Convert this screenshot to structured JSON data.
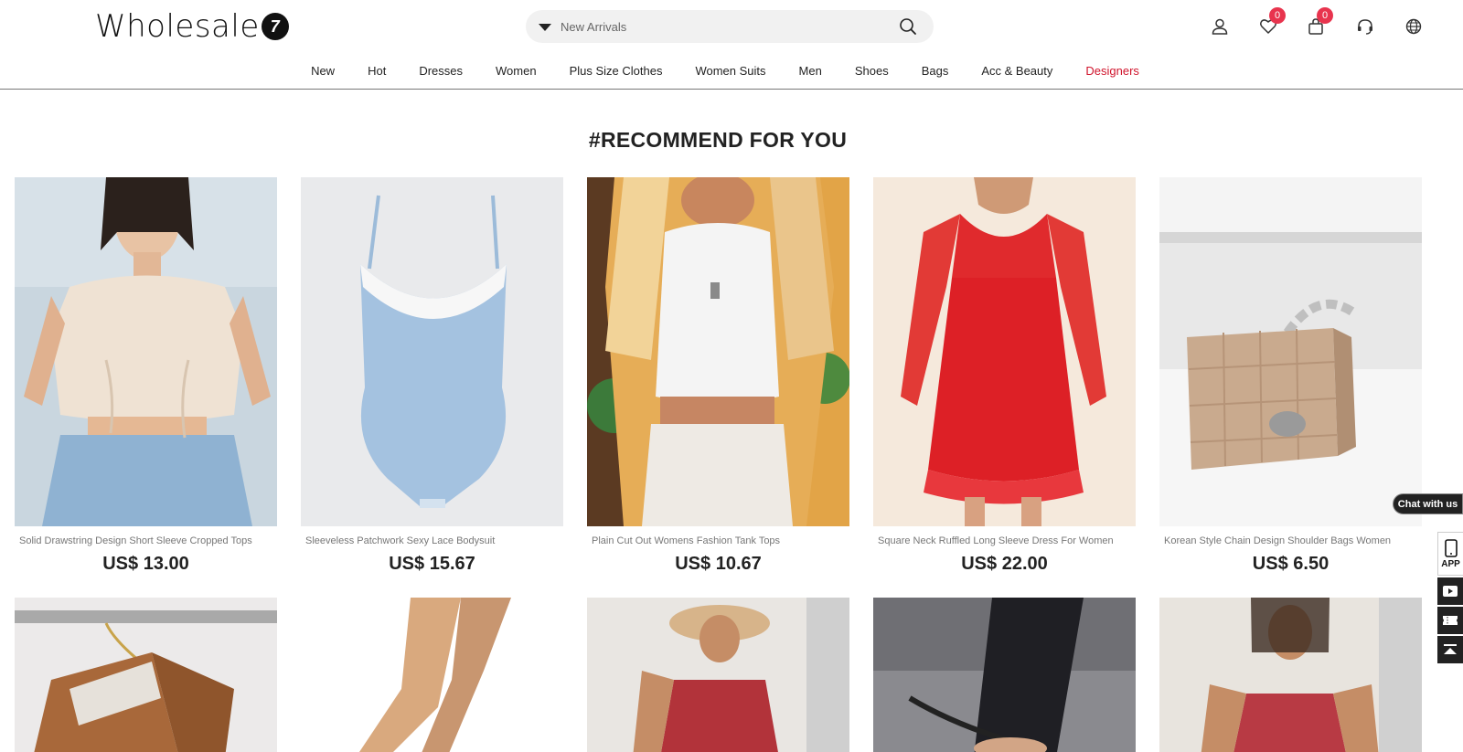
{
  "header": {
    "logo_text": "Wholesale",
    "logo_badge": "7",
    "search_placeholder": "New Arrivals",
    "wishlist_count": "0",
    "cart_count": "0"
  },
  "nav": [
    {
      "label": "New"
    },
    {
      "label": "Hot"
    },
    {
      "label": "Dresses"
    },
    {
      "label": "Women"
    },
    {
      "label": "Plus Size Clothes"
    },
    {
      "label": "Women Suits"
    },
    {
      "label": "Men"
    },
    {
      "label": "Shoes"
    },
    {
      "label": "Bags"
    },
    {
      "label": "Acc & Beauty"
    },
    {
      "label": "Designers"
    }
  ],
  "section_title": "#RECOMMEND FOR YOU",
  "products": [
    {
      "title": "Solid Drawstring Design Short Sleeve Cropped Tops",
      "price": "US$ 13.00"
    },
    {
      "title": "Sleeveless Patchwork Sexy Lace Bodysuit",
      "price": "US$ 15.67"
    },
    {
      "title": "Plain Cut Out Womens Fashion Tank Tops",
      "price": "US$ 10.67"
    },
    {
      "title": "Square Neck Ruffled Long Sleeve Dress For Women",
      "price": "US$ 22.00"
    },
    {
      "title": "Korean Style Chain Design Shoulder Bags Women",
      "price": "US$ 6.50"
    }
  ],
  "side": {
    "chat_label": "Chat with us",
    "app_label": "APP"
  },
  "colors": {
    "accent": "#d0142c",
    "badge": "#e8344e",
    "dark": "#222222"
  }
}
